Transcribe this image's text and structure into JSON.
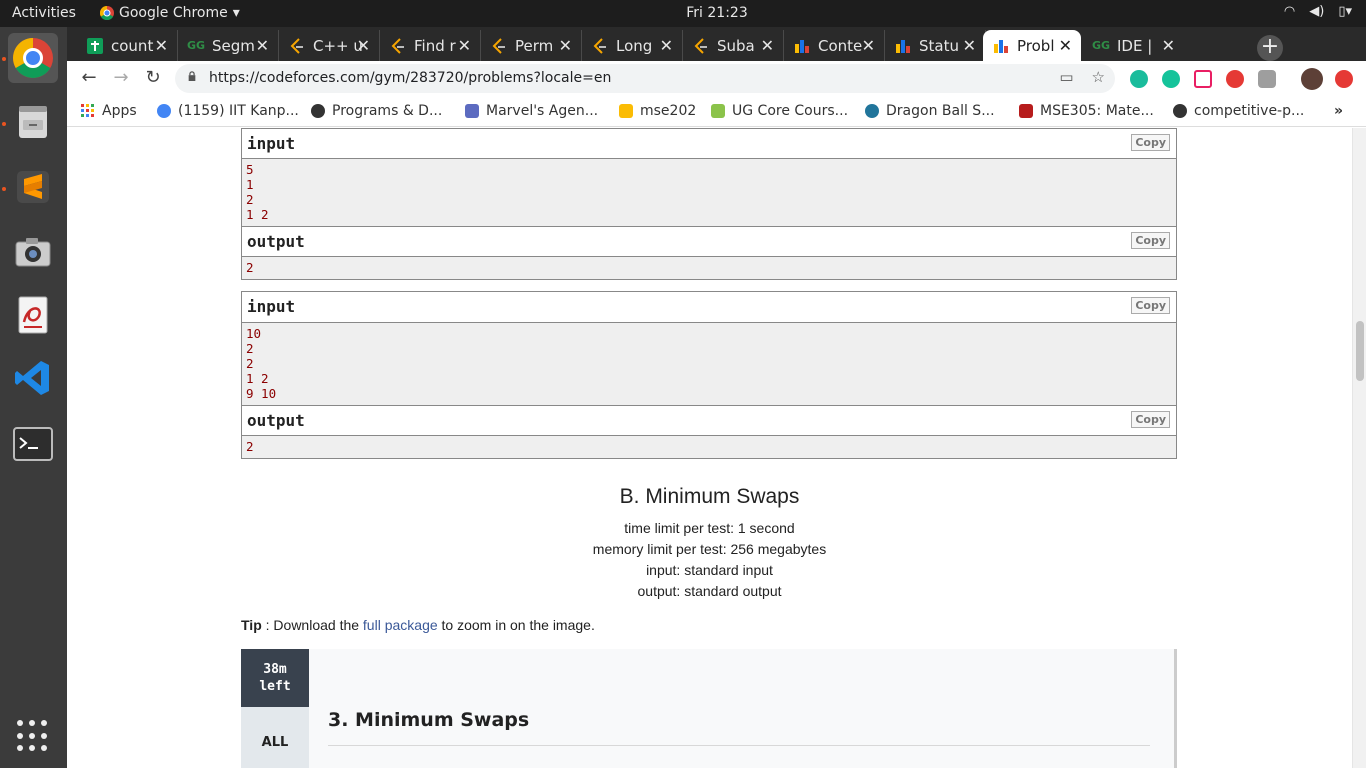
{
  "os": {
    "activities": "Activities",
    "app_name": "Google Chrome",
    "clock": "Fri 21:23"
  },
  "tabs": [
    {
      "title": "count",
      "color": "#0f9d58"
    },
    {
      "title": "Segm",
      "color": "#2f8d46"
    },
    {
      "title": "C++ u",
      "color": "#f6a500"
    },
    {
      "title": "Find r",
      "color": "#f6a500"
    },
    {
      "title": "Perm",
      "color": "#f6a500"
    },
    {
      "title": "Long",
      "color": "#f6a500"
    },
    {
      "title": "Suba",
      "color": "#f6a500"
    },
    {
      "title": "Conte",
      "color": "#1a73e8"
    },
    {
      "title": "Statu",
      "color": "#1a73e8"
    },
    {
      "title": "Probl",
      "color": "#1a73e8"
    },
    {
      "title": "IDE |",
      "color": "#2f8d46"
    }
  ],
  "address_bar": {
    "url": "https://codeforces.com/gym/283720/problems?locale=en"
  },
  "bookmarks": [
    {
      "label": "Apps",
      "color": "#e53935"
    },
    {
      "label": "(1159) IIT Kanp...",
      "color": "#4285f4"
    },
    {
      "label": "Programs & D...",
      "color": "#333333"
    },
    {
      "label": "Marvel's Agen...",
      "color": "#5c6bc0"
    },
    {
      "label": "mse202",
      "color": "#fbbc04"
    },
    {
      "label": "UG Core Cours...",
      "color": "#8bc34a"
    },
    {
      "label": "Dragon Ball S...",
      "color": "#21759b"
    },
    {
      "label": "MSE305: Mate...",
      "color": "#b71c1c"
    },
    {
      "label": "competitive-p...",
      "color": "#333333"
    }
  ],
  "samples": [
    {
      "input_label": "input",
      "output_label": "output",
      "copy": "Copy",
      "input_lines": [
        "5",
        "1",
        "2",
        "1 2"
      ],
      "output_lines": [
        "2"
      ]
    },
    {
      "input_label": "input",
      "output_label": "output",
      "copy": "Copy",
      "input_lines": [
        "10",
        "2",
        "2",
        "1 2",
        "9 10"
      ],
      "output_lines": [
        "2"
      ]
    }
  ],
  "problem": {
    "title": "B. Minimum Swaps",
    "time_limit": "time limit per test: 1 second",
    "memory_limit": "memory limit per test: 256 megabytes",
    "input": "input: standard input",
    "output": "output: standard output",
    "tip_bold": "Tip",
    "tip_pre": " : Download the ",
    "tip_link": "full package",
    "tip_post": " to zoom in on the image."
  },
  "embedded_image": {
    "timer_line1": "38m",
    "timer_line2": "left",
    "all": "ALL",
    "title": "3. Minimum Swaps"
  }
}
